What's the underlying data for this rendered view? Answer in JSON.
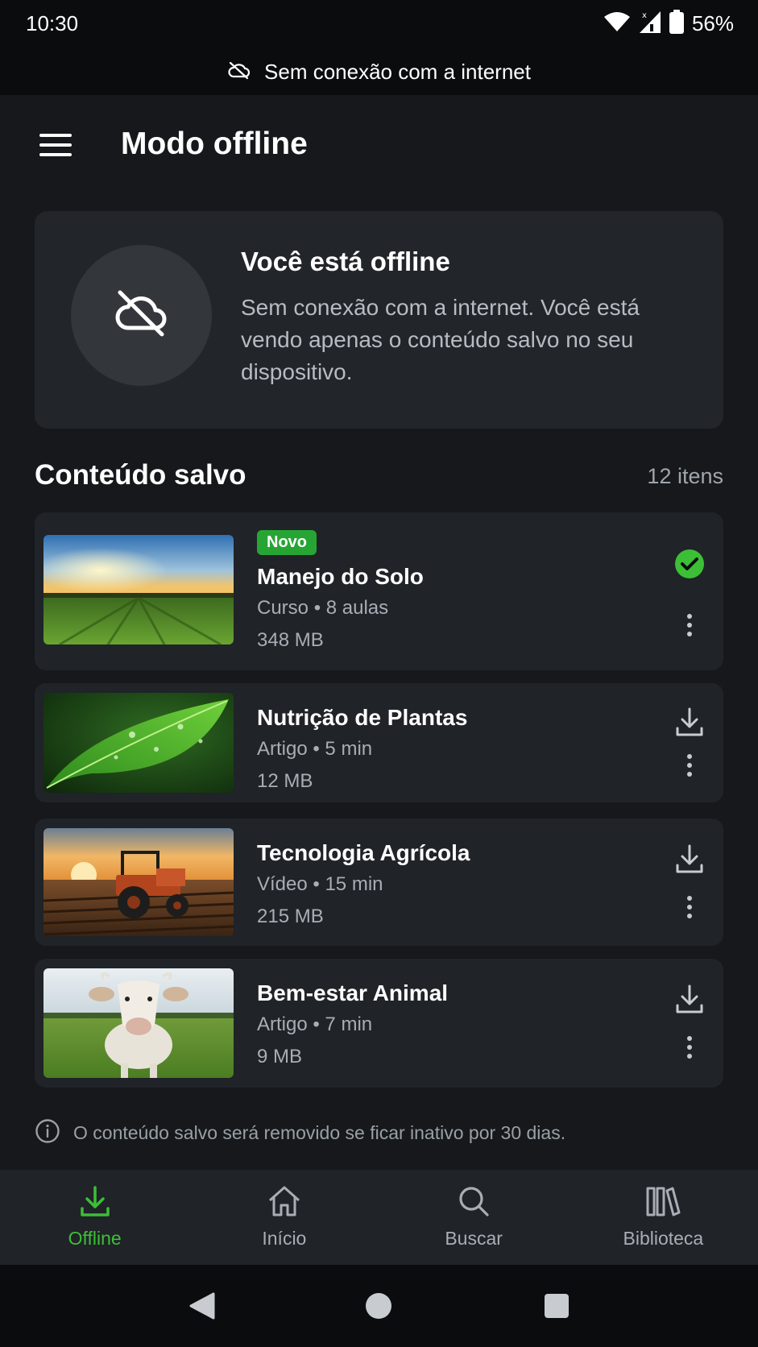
{
  "status_bar": {
    "time": "10:30",
    "battery_percent": "56%",
    "icons": [
      "wifi-icon",
      "signal-no-data-icon",
      "battery-icon"
    ]
  },
  "connection_banner": {
    "icon": "cloud-off-icon",
    "text": "Sem conexão com a internet"
  },
  "header": {
    "menu_icon": "hamburger-menu-icon",
    "title": "Modo offline"
  },
  "offline_card": {
    "icon": "cloud-off-icon",
    "title": "Você está offline",
    "description": "Sem conexão com a internet. Você está vendo apenas o conteúdo salvo no seu dispositivo."
  },
  "saved_section": {
    "title": "Conteúdo salvo",
    "count": "12 itens",
    "items": [
      {
        "badge": "Novo",
        "title": "Manejo do Solo",
        "meta": "Curso • 8 aulas",
        "size": "348 MB",
        "status": "downloaded",
        "status_icon": "check-circle-icon",
        "thumbnail": "sunset-field-image"
      },
      {
        "badge": "",
        "title": "Nutrição de Plantas",
        "meta": "Artigo • 5 min",
        "size": "12 MB",
        "status": "available",
        "status_icon": "download-icon",
        "thumbnail": "leaf-image"
      },
      {
        "badge": "",
        "title": "Tecnologia Agrícola",
        "meta": "Vídeo • 15 min",
        "size": "215 MB",
        "status": "available",
        "status_icon": "download-icon",
        "thumbnail": "tractor-image"
      },
      {
        "badge": "",
        "title": "Bem-estar Animal",
        "meta": "Artigo • 7 min",
        "size": "9 MB",
        "status": "available",
        "status_icon": "download-icon",
        "thumbnail": "cow-image"
      }
    ]
  },
  "footer_note": {
    "icon": "info-icon",
    "text": "O conteúdo salvo será removido se ficar inativo por 30 dias."
  },
  "bottom_nav": {
    "items": [
      {
        "label": "Offline",
        "icon": "download-icon",
        "active": true
      },
      {
        "label": "Início",
        "icon": "home-icon",
        "active": false
      },
      {
        "label": "Buscar",
        "icon": "search-icon",
        "active": false
      },
      {
        "label": "Biblioteca",
        "icon": "library-icon",
        "active": false
      }
    ]
  },
  "colors": {
    "accent": "#3cbf36",
    "badge": "#27a534",
    "background": "#16181b",
    "card": "#202328"
  }
}
